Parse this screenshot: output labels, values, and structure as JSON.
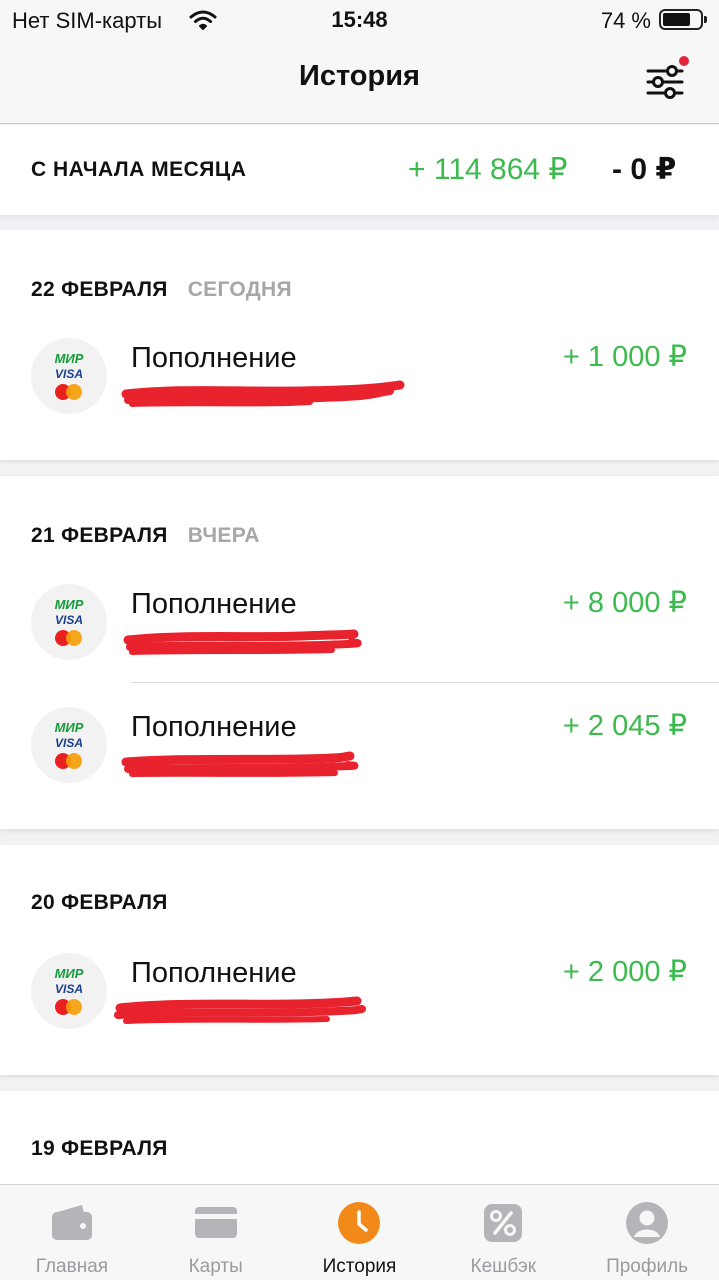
{
  "status_bar": {
    "carrier": "Нет SIM-карты",
    "time": "15:48",
    "battery_percent": "74 %",
    "battery_level": 0.74
  },
  "header": {
    "title": "История",
    "filter_icon": "sliders-icon",
    "filter_has_notification": true
  },
  "summary": {
    "label": "С НАЧАЛА МЕСЯЦА",
    "income": "+ 114 864 ₽",
    "expense": "- 0 ₽"
  },
  "days": [
    {
      "date": "22 ФЕВРАЛЯ",
      "relative": "СЕГОДНЯ",
      "transactions": [
        {
          "title": "Пополнение",
          "amount": "+ 1 000 ₽",
          "logo_mir": "МИР",
          "logo_visa": "VISA"
        }
      ]
    },
    {
      "date": "21 ФЕВРАЛЯ",
      "relative": "ВЧЕРА",
      "transactions": [
        {
          "title": "Пополнение",
          "amount": "+ 8 000 ₽",
          "logo_mir": "МИР",
          "logo_visa": "VISA"
        },
        {
          "title": "Пополнение",
          "amount": "+ 2 045 ₽",
          "logo_mir": "МИР",
          "logo_visa": "VISA"
        }
      ]
    },
    {
      "date": "20 ФЕВРАЛЯ",
      "relative": "",
      "transactions": [
        {
          "title": "Пополнение",
          "amount": "+ 2 000 ₽",
          "logo_mir": "МИР",
          "logo_visa": "VISA"
        }
      ]
    },
    {
      "date": "19 ФЕВРАЛЯ",
      "relative": "",
      "transactions": []
    }
  ],
  "tab_bar": {
    "tabs": [
      {
        "label": "Главная",
        "icon": "wallet-icon",
        "active": false
      },
      {
        "label": "Карты",
        "icon": "card-icon",
        "active": false
      },
      {
        "label": "История",
        "icon": "clock-icon",
        "active": true
      },
      {
        "label": "Кешбэк",
        "icon": "percent-icon",
        "active": false
      },
      {
        "label": "Профиль",
        "icon": "profile-icon",
        "active": false
      }
    ]
  },
  "colors": {
    "income": "#3dba4e",
    "accent": "#f28a1a",
    "redaction": "#e8232d",
    "muted": "#a7a7aa"
  }
}
